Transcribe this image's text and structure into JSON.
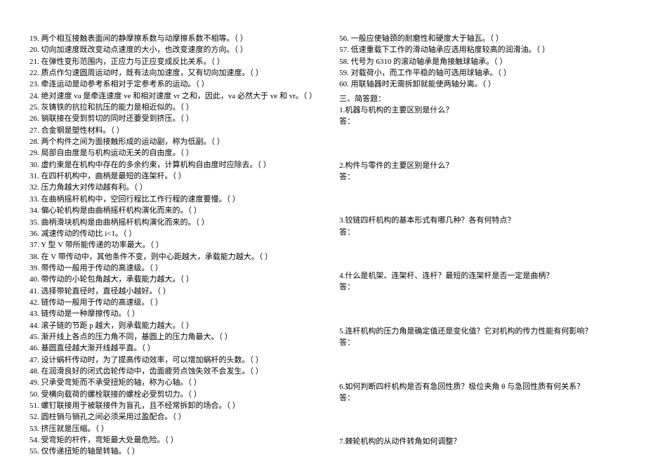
{
  "left": [
    "19.  两个相互接触表面间的静摩擦系数与动摩擦系数不相等。（      ）",
    "20.  切向加速度既改变动点速度的大小，也改变速度的方向。（      ）",
    "21.  在弹性变形范围内，正应力与正应变成反比关系。（      ）",
    "22.  质点作匀速圆周运动时，既有法向加速度，又有切向加速度。（      ）",
    "23.  牵连运动是动参考系相对于定参考系的运动。（      ）",
    "24.  绝对速度 va 是牵连速度 ve 和相对速度 vr 之和，因此，va 必然大于 ve 和 vr。（      ）",
    "25.  灰铸铁的抗拉和抗压的能力是相近似的。（      ）",
    "26.  销联接在受到剪切的同时还要受到挤压。（      ）",
    "27.  合金钢是塑性材料。（      ）",
    "28.  两个构件之间为面接触形成的运动副，称为低副。（      ）",
    "29.  局部自由度是与机构运动无关的自由度。（      ）",
    "30.  虚约束是在机构中存在的多余约束，计算机构自由度时应除去。（      ）",
    "31.  在四杆机构中，曲柄是最短的连架杆。（      ）",
    "32.  压力角越大对传动越有利。（      ）",
    "33.  在曲柄摇杆机构中，空回行程比工作行程的速度要慢。（      ）",
    "34.  偏心轮机构是由曲柄摇杆机构演化而来的。（      ）",
    "35.  曲柄滑块机构是由曲柄摇杆机构演化而来的。（      ）",
    "36.  减速传动的传动比 i<1。（      ）",
    "37.  Y 型 V 带所能传递的功率最大。（      ）",
    "38.  在 V 带传动中，其他条件不变，则中心距越大，承载能力越大。（      ）",
    "39.  带传动一般用于传动的高速级。（      ）",
    "40.  带传动的小轮包角越大，承载能力越大。（      ）",
    "41.  选择带轮直径时，直径越小越好。（      ）",
    "42.  链传动一般用于传动的高速级。（      ）",
    "43.  链传动是一种摩擦传动。（      ）",
    "44.  滚子链的节距 p 越大，则承载能力越大。（      ）",
    "45.  渐开线上各点的压力角不同，基圆上的压力角最大。（      ）",
    "46.  基圆直径越大渐开线越平直。（      ）",
    "47.  设计蜗杆传动时，为了提高传动效率，可以增加蜗杆的头数。（      ）",
    "48.  在润滑良好的闭式齿轮传动中，齿面疲劳点蚀失效不会发生。（      ）",
    "49.  只承受弯矩而不承受扭矩的轴，称为心轴。（      ）",
    "50.  受横向载荷的螺栓联接的螺栓必受剪切力。（      ）",
    "51.  螺钉联接用于被联接件为盲孔，且不经常拆卸的场合。（      ）",
    "52.  圆柱销与销孔之间必须采用过盈配合。（      ）",
    "53.  挤压就是压缩。（      ）",
    "54.  受弯矩的杆件，弯矩最大处最危险。（      ）",
    "55.  仅传递扭矩的轴是转轴。（      ）"
  ],
  "right_top": [
    "56.  一般应使轴颈的耐磨性和硬度大于轴瓦。（      ）",
    "57.  低速重载下工作的滑动轴承应选用粘度较高的润滑油。（      ）",
    "58.  代号为 6310 的滚动轴承是角接触球轴承。（      ）",
    "59.  对载荷小，而工作平稳的轴可选用球轴承。（      ）",
    "60.  用联轴器时无需拆卸就能使两轴分离。（      ）"
  ],
  "right_section_title": "三、简答题：",
  "qa": [
    {
      "q": "1.机器与机构的主要区别是什么？",
      "a": "答："
    },
    {
      "q": "2.构件与零件的主要区别是什么？",
      "a": "答："
    },
    {
      "q": "3.铰链四杆机构的基本形式有哪几种？各有何特点？",
      "a": "答："
    },
    {
      "q": "4.什么是机架、连架杆、连杆？最短的连架杆是否一定是曲柄？",
      "a": "答："
    },
    {
      "q": "5.连杆机构的压力角是确定值还是变化值？它对机构的传力性能有何影响？",
      "a": "答："
    },
    {
      "q": "6.如何判断四杆机构是否有急回性质？极位夹角 θ 与急回性质有何关系？",
      "a": "答："
    },
    {
      "q": "7.棘轮机构的从动件转角如何调整？",
      "a": ""
    }
  ]
}
